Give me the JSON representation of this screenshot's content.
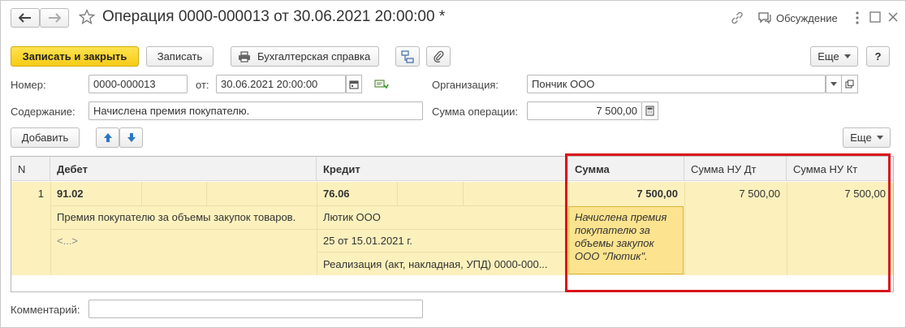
{
  "window": {
    "title": "Операция 0000-000013 от 30.06.2021 20:00:00 *",
    "discussion_label": "Обсуждение"
  },
  "toolbar": {
    "save_close_label": "Записать и закрыть",
    "save_label": "Записать",
    "accounting_ref_label": "Бухгалтерская справка",
    "more_label": "Еще",
    "help_label": "?"
  },
  "form": {
    "number_label": "Номер:",
    "number_value": "0000-000013",
    "date_label": "от:",
    "date_value": "30.06.2021 20:00:00",
    "org_label": "Организация:",
    "org_value": "Пончик ООО",
    "content_label": "Содержание:",
    "content_value": "Начислена премия покупателю.",
    "amount_label": "Сумма операции:",
    "amount_value": "7 500,00",
    "comment_label": "Комментарий:",
    "comment_value": ""
  },
  "table_toolbar": {
    "add_label": "Добавить",
    "more_label": "Еще"
  },
  "table": {
    "columns": [
      "N",
      "Дебет",
      "Кредит",
      "Сумма",
      "Сумма НУ Дт",
      "Сумма НУ Кт"
    ],
    "row": {
      "n": "1",
      "debit_account": "91.02",
      "debit_subconto1": "Премия покупателю за объемы закупок товаров.",
      "debit_subconto2": "<...>",
      "credit_account": "76.06",
      "credit_subconto1": "Лютик ООО",
      "credit_subconto2": "25 от 15.01.2021 г.",
      "credit_subconto3": "Реализация (акт, накладная, УПД) 0000-000...",
      "amount": "7 500,00",
      "amount_content": "Начислена премия покупателю за объемы закупок ООО \"Лютик\".",
      "tax_debit": "7 500,00",
      "tax_credit": "7 500,00"
    }
  },
  "colors": {
    "accent_yellow": "#f6cb15",
    "row_highlight": "#fcf1bd",
    "annotation_red": "#d9141c"
  }
}
